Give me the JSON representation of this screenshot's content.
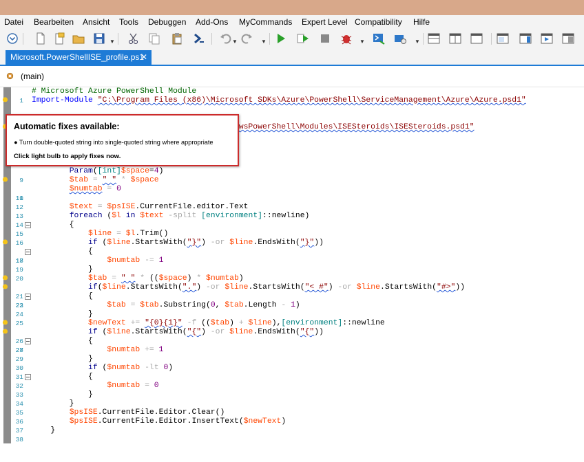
{
  "menu": [
    "Datei",
    "Bearbeiten",
    "Ansicht",
    "Tools",
    "Debuggen",
    "Add-Ons",
    "MyCommands",
    "Expert Level",
    "Compatibility",
    "Hilfe"
  ],
  "toolbar": {
    "icons": [
      "customize-icon",
      "new-file-icon",
      "new-remote-icon",
      "open-folder-icon",
      "save-icon",
      "cut-icon",
      "copy-icon",
      "paste-icon",
      "powershell-icon",
      "undo-icon",
      "redo-icon",
      "run-icon",
      "run-selection-icon",
      "stop-icon",
      "debug-icon",
      "remote-powershell-icon",
      "start-powershell-icon",
      "show-script-pane-top-icon",
      "show-script-pane-right-icon",
      "show-script-pane-maximized-icon",
      "show-command-window-icon",
      "show-command-addon-icon"
    ]
  },
  "tab": {
    "title": "Microsoft.PowerShellISE_profile.ps1",
    "close": "✕"
  },
  "breadcrumb": {
    "text": "(main)"
  },
  "editor": {
    "line_numbers": [
      "1",
      "2",
      "",
      "",
      "",
      "",
      "",
      "",
      "9",
      "10",
      "11",
      "12",
      "13",
      "14",
      "15",
      "16",
      "17",
      "18",
      "19",
      "20",
      "21",
      "22",
      "23",
      "24",
      "25",
      "26",
      "27",
      "28",
      "29",
      "30",
      "31",
      "32",
      "33",
      "34",
      "35",
      "36",
      "37",
      "38"
    ]
  },
  "popup": {
    "title": "Automatic fixes available:",
    "item": "● Turn double-quoted string into single-quoted string where appropriate",
    "footer": "Click light bulb to apply fixes now."
  },
  "colors": {
    "accent": "#1e7bd6",
    "popup_border": "#cc2b2b",
    "titlebar": "#d8a88a"
  }
}
